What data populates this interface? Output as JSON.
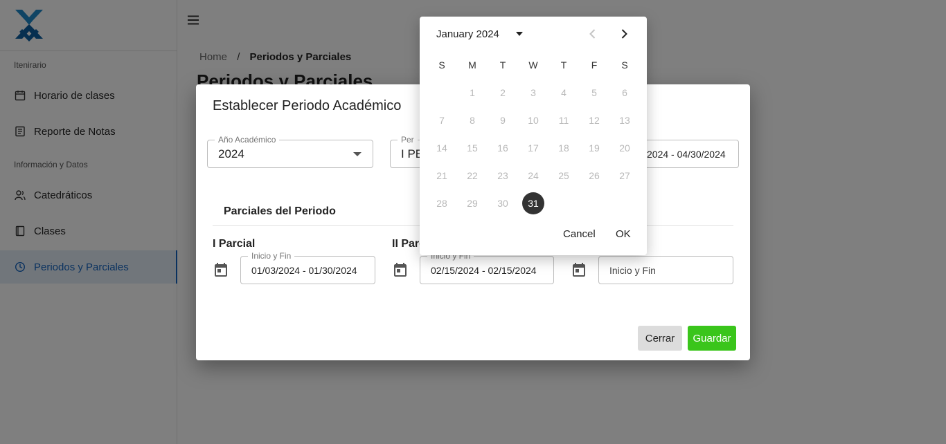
{
  "sidebar": {
    "section1": "Itenirario",
    "section2": "Información y Datos",
    "items": [
      {
        "label": "Horario de clases",
        "icon": "calendar-icon"
      },
      {
        "label": "Reporte de Notas",
        "icon": "report-icon"
      },
      {
        "label": "Catedráticos",
        "icon": "people-icon"
      },
      {
        "label": "Clases",
        "icon": "book-icon"
      },
      {
        "label": "Periodos y Parciales",
        "icon": "clock-icon",
        "active": true
      }
    ],
    "accent": "#1565c0"
  },
  "breadcrumb": {
    "home": "Home",
    "separator": "/",
    "current": "Periodos y Parciales"
  },
  "page": {
    "title": "Periodos y Parciales"
  },
  "dialog": {
    "title": "Establecer Periodo Académico",
    "anio": {
      "legend": "Año Académico",
      "value": "2024"
    },
    "periodo": {
      "legend": "Per",
      "value": "I PE"
    },
    "fechas": {
      "value": "2024 - 04/30/2024"
    },
    "parciales_header": "Parciales del Periodo",
    "parciales": [
      {
        "label": "I Parcial",
        "legend": "Inicio y Fin",
        "value": "01/03/2024 - 01/30/2024"
      },
      {
        "label": "II Parc",
        "legend": "Inicio y Fin",
        "value": "02/15/2024 - 02/15/2024"
      },
      {
        "label": "",
        "legend": "",
        "value": "Inicio y Fin"
      }
    ],
    "buttons": {
      "close": "Cerrar",
      "save": "Guardar"
    },
    "save_color": "#3ac51b"
  },
  "datepicker": {
    "month_label": "January 2024",
    "weekdays": [
      "S",
      "M",
      "T",
      "W",
      "T",
      "F",
      "S"
    ],
    "first_weekday": 1,
    "days_in_month": 31,
    "selected_day": 31,
    "cancel": "Cancel",
    "ok": "OK"
  }
}
